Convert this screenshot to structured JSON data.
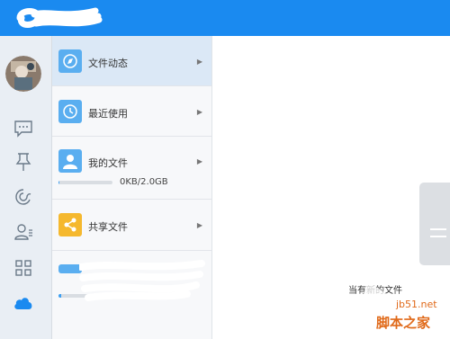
{
  "titlebar": {
    "logo": "redacted-scribble"
  },
  "rail": {
    "icons": [
      "message-icon",
      "pin-icon",
      "call-icon",
      "contacts-icon",
      "apps-icon",
      "cloud-icon"
    ]
  },
  "panel": {
    "items": [
      {
        "label": "文件动态",
        "icon": "compass-icon",
        "icon_color": "#5aaef0"
      },
      {
        "label": "最近使用",
        "icon": "clock-icon",
        "icon_color": "#5aaef0"
      },
      {
        "label": "我的文件",
        "icon": "user-icon",
        "icon_color": "#5aaef0",
        "quota_text": "0KB/2.0GB",
        "quota_fraction": 0.02
      },
      {
        "label": "共享文件",
        "icon": "share-icon",
        "icon_color": "#f5b82e"
      }
    ]
  },
  "main": {
    "notice": "当有新的文件"
  },
  "watermark": {
    "site": "jb51.net",
    "name": "脚本之家"
  },
  "colors": {
    "accent": "#1a8af0",
    "rail_bg": "#e9eef4",
    "active_item": "#dbe8f6"
  }
}
